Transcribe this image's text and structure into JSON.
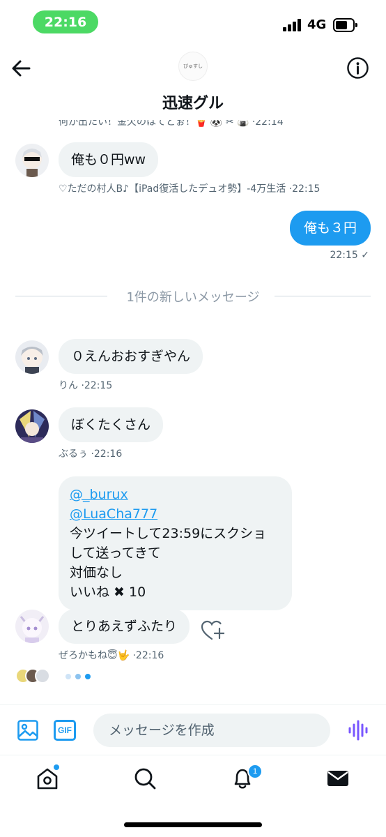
{
  "status_bar": {
    "time": "22:16",
    "network": "4G"
  },
  "header": {
    "title": "迅速グル",
    "group_avatar_text": "ぴゅすし"
  },
  "chat": {
    "cut_off_line": "何か出たい！金欠のはてとぉ！🍟 🐼 ✂ 🍙 ·22:14",
    "messages": [
      {
        "text": "俺も０円ww",
        "meta": "♡ただの村人B♪【iPad復活したデュオ勢】-4万生活 ·22:15"
      },
      {
        "text": "俺も３円",
        "meta": "22:15 ✓"
      },
      {
        "text": "０えんおおすぎやん",
        "meta": "りん ·22:15"
      },
      {
        "text": "ぼくたくさん",
        "meta": "ぶるぅ ·22:16"
      },
      {
        "mention1": "@_burux",
        "mention2": "@LuaCha777",
        "line1": "今ツイートして23:59にスクショ",
        "line2": "して送ってきて",
        "line3": "対価なし",
        "line4": "いいね ✖ 10"
      },
      {
        "text": "とりあえずふたり",
        "meta": "ぜろかもね😇🤟 ·22:16"
      }
    ],
    "divider_label": "1件の新しいメッセージ"
  },
  "composer": {
    "placeholder": "メッセージを作成",
    "gif_label": "GIF"
  },
  "tabbar": {
    "notification_count": "1"
  },
  "colors": {
    "accent": "#1d9bf0",
    "bubble": "#eff3f4",
    "status_green": "#4cd964",
    "voice": "#7856ff"
  }
}
